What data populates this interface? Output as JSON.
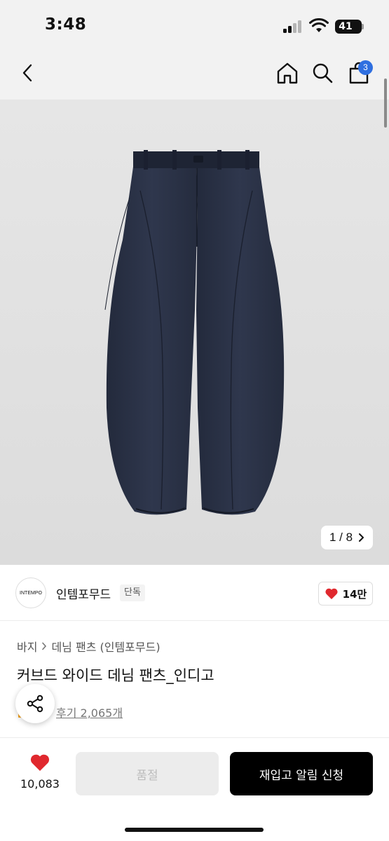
{
  "status_bar": {
    "time": "3:48",
    "battery": "41"
  },
  "nav": {
    "cart_count": "3"
  },
  "gallery": {
    "counter": "1 / 8"
  },
  "brand": {
    "logo_text": "INTEMPO",
    "name": "인템포무드",
    "tag": "단독",
    "likes": "14만"
  },
  "breadcrumb": {
    "category": "바지",
    "subcategory": "데님 팬츠 (인템포무드)"
  },
  "product": {
    "title": "커브드 와이드 데님 팬츠_인디고",
    "reviews": "후기 2,065개"
  },
  "bottom_bar": {
    "wish_count": "10,083",
    "soldout_label": "품절",
    "restock_label": "재입고 알림 신청"
  },
  "colors": {
    "accent": "#2f6fe0",
    "like_red": "#e0282e",
    "denim": "#2a3145"
  }
}
